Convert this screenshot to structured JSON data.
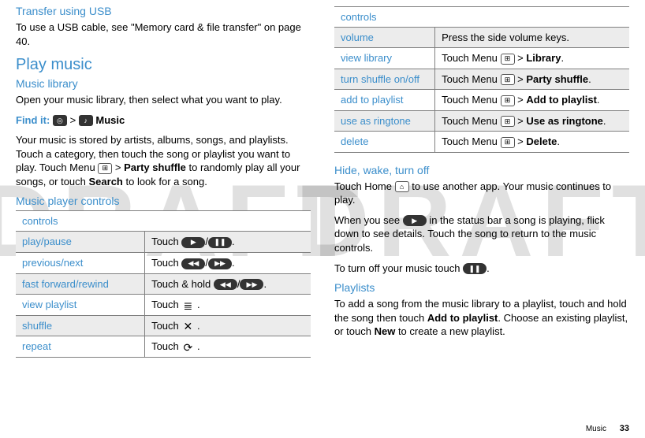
{
  "watermark": "DRAFT",
  "left": {
    "transfer_h": "Transfer using USB",
    "transfer_p": "To use a USB cable, see \"Memory card & file transfer\" on page 40.",
    "play_h": "Play music",
    "lib_h": "Music library",
    "lib_p": "Open your music library, then select what you want to play.",
    "findit_label": "Find it:",
    "findit_gt": " > ",
    "findit_music": "Music",
    "stored_p1": "Your music is stored by artists, albums, songs, and playlists. Touch a category, then touch the song or playlist you want to play. Touch Menu ",
    "stored_p2": " > ",
    "stored_b1": "Party shuffle",
    "stored_p3": " to randomly play all your songs, or touch ",
    "stored_b2": "Search",
    "stored_p4": " to look for a song.",
    "controls_h": "Music player controls"
  },
  "table1": {
    "header": "controls",
    "rows": [
      {
        "label": "play/pause",
        "pre": "Touch ",
        "icon1": "▶",
        "mid": "/",
        "icon2": "❚❚",
        "post": "."
      },
      {
        "label": "previous/next",
        "pre": "Touch ",
        "icon1": "◀◀",
        "mid": "/",
        "icon2": "▶▶",
        "post": "."
      },
      {
        "label": "fast forward/rewind",
        "pre": "Touch & hold ",
        "icon1": "◀◀",
        "mid": "/",
        "icon2": "▶▶",
        "post": "."
      },
      {
        "label": "view playlist",
        "pre": "Touch ",
        "glyph": "≣",
        "post": " ."
      },
      {
        "label": "shuffle",
        "pre": "Touch ",
        "glyph": "✕",
        "post": " ."
      },
      {
        "label": "repeat",
        "pre": "Touch ",
        "glyph": "⟳",
        "post": " ."
      }
    ]
  },
  "table2": {
    "header": "controls",
    "rows": [
      {
        "label": "volume",
        "plain": "Press the side volume keys."
      },
      {
        "label": "view library",
        "pre": "Touch Menu ",
        "bold": "Library",
        "post": "."
      },
      {
        "label": "turn shuffle on/off",
        "pre": "Touch Menu ",
        "bold": "Party shuffle",
        "post": "."
      },
      {
        "label": "add to playlist",
        "pre": "Touch Menu ",
        "bold": "Add to playlist",
        "post": "."
      },
      {
        "label": "use as ringtone",
        "pre": "Touch Menu ",
        "bold": "Use as ringtone",
        "post": "."
      },
      {
        "label": "delete",
        "pre": "Touch Menu ",
        "bold": "Delete",
        "post": "."
      }
    ]
  },
  "right": {
    "hide_h": "Hide, wake, turn off",
    "hide_p1a": "Touch Home ",
    "hide_p1b": " to use another app. Your music continues to play.",
    "hide_p2a": "When you see ",
    "hide_p2b": " in the status bar a song is playing, flick down to see details. Touch the song to return to the music controls.",
    "hide_p3a": "To turn off your music touch ",
    "hide_p3b": ".",
    "pl_h": "Playlists",
    "pl_p1": "To add a song from the music library to a playlist, touch and hold the song then touch ",
    "pl_b1": "Add to playlist",
    "pl_p2": ". Choose an existing playlist, or touch ",
    "pl_b2": "New",
    "pl_p3": " to create a new playlist."
  },
  "footer": {
    "section": "Music",
    "page": "33"
  },
  "gt": " > "
}
